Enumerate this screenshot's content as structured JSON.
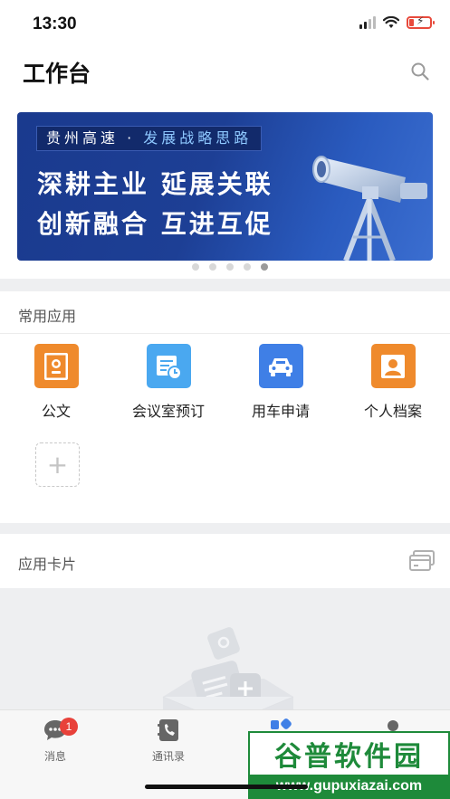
{
  "status_bar": {
    "time": "13:30"
  },
  "header": {
    "title": "工作台",
    "search_icon": "search-icon"
  },
  "banner": {
    "tag_prefix": "贵州高速 · ",
    "tag_highlight": "发展战略思路",
    "line1": "深耕主业 延展关联",
    "line2": "创新融合 互进互促",
    "page_count": 5,
    "active_page": 5
  },
  "common_apps": {
    "title": "常用应用",
    "items": [
      {
        "label": "公文",
        "icon": "document-seal-icon",
        "color": "#ef8a2c"
      },
      {
        "label": "会议室预订",
        "icon": "meeting-booking-icon",
        "color": "#4aa8f0"
      },
      {
        "label": "用车申请",
        "icon": "car-icon",
        "color": "#3f7fe6"
      },
      {
        "label": "个人档案",
        "icon": "profile-icon",
        "color": "#ef8a2c"
      }
    ],
    "add_label": "+"
  },
  "app_cards": {
    "title": "应用卡片",
    "icon": "card-icon"
  },
  "tabbar": {
    "items": [
      {
        "label": "消息",
        "icon": "chat-icon",
        "badge": "1"
      },
      {
        "label": "通讯录",
        "icon": "contacts-icon"
      },
      {
        "label": "",
        "icon": "workbench-icon"
      },
      {
        "label": "",
        "icon": "user-icon"
      }
    ]
  },
  "watermark": {
    "title": "谷普软件园",
    "url": "www.gupuxiazai.com"
  },
  "colors": {
    "accent": "#3f7fe6",
    "badge": "#e8413a",
    "banner": "#1d3f95",
    "watermark": "#1e8a3a"
  }
}
